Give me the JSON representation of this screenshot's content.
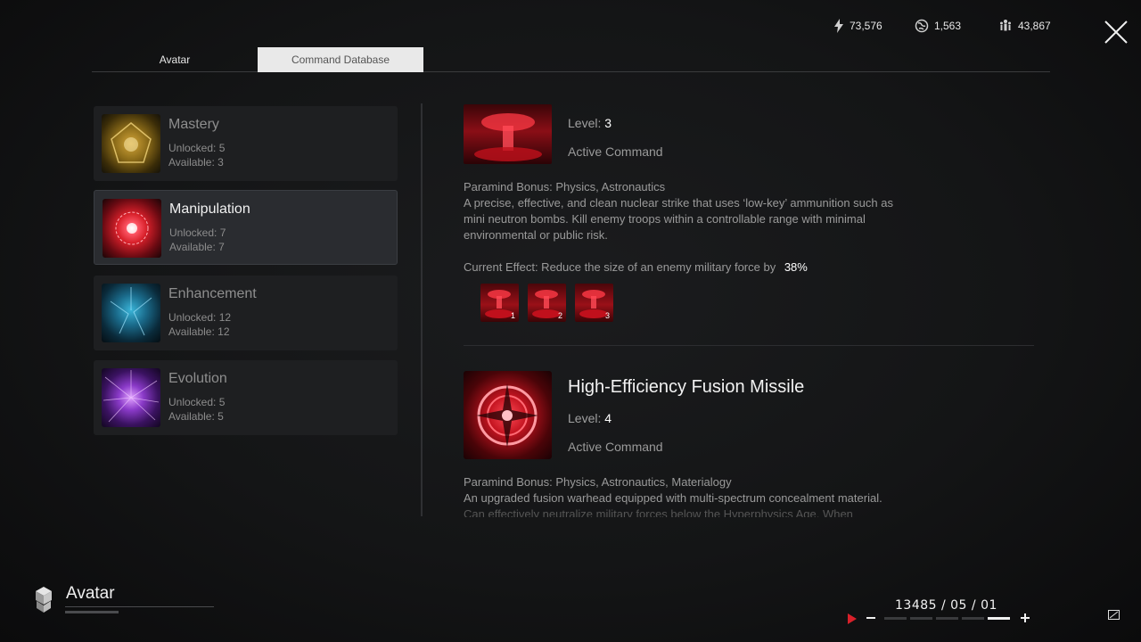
{
  "resources": [
    {
      "icon": "energy-icon",
      "value": "73,576"
    },
    {
      "icon": "globe-icon",
      "value": "1,563"
    },
    {
      "icon": "population-icon",
      "value": "43,867"
    }
  ],
  "tabs": [
    {
      "label": "Avatar",
      "active": false
    },
    {
      "label": "Command Database",
      "active": true
    }
  ],
  "categories": [
    {
      "title": "Mastery",
      "unlocked": "Unlocked: 5",
      "available": "Available: 3",
      "selected": false
    },
    {
      "title": "Manipulation",
      "unlocked": "Unlocked: 7",
      "available": "Available: 7",
      "selected": true
    },
    {
      "title": "Enhancement",
      "unlocked": "Unlocked: 12",
      "available": "Available: 12",
      "selected": false
    },
    {
      "title": "Evolution",
      "unlocked": "Unlocked: 5",
      "available": "Available: 5",
      "selected": false
    }
  ],
  "commands": [
    {
      "name": "",
      "level_label": "Level:",
      "level": "3",
      "type": "Active Command",
      "bonus": "Paramind Bonus: Physics, Astronautics",
      "description": "A precise, effective, and clean nuclear strike that uses ‘low-key’ ammunition such as mini neutron bombs. Kill enemy troops within a controllable range with minimal environmental or public risk.",
      "effect_label": "Current Effect: Reduce the size of an enemy military force by",
      "effect_value": "38%",
      "tiers": [
        "1",
        "2",
        "3"
      ]
    },
    {
      "name": "High-Efficiency Fusion Missile",
      "level_label": "Level:",
      "level": "4",
      "type": "Active Command",
      "bonus": "Paramind Bonus: Physics, Astronautics, Materialogy",
      "description": "An upgraded fusion warhead equipped with multi-spectrum concealment material.",
      "description_cut": "Can effectively neutralize military forces below the Hyperphysics Age. When"
    }
  ],
  "footer": {
    "section_title": "Avatar",
    "date": "13485 / 05 / 01",
    "speed_level": 5,
    "speed_max": 5
  },
  "colors": {
    "accent_red": "#d8202a",
    "tab_active_bg": "#e9e9e9"
  }
}
